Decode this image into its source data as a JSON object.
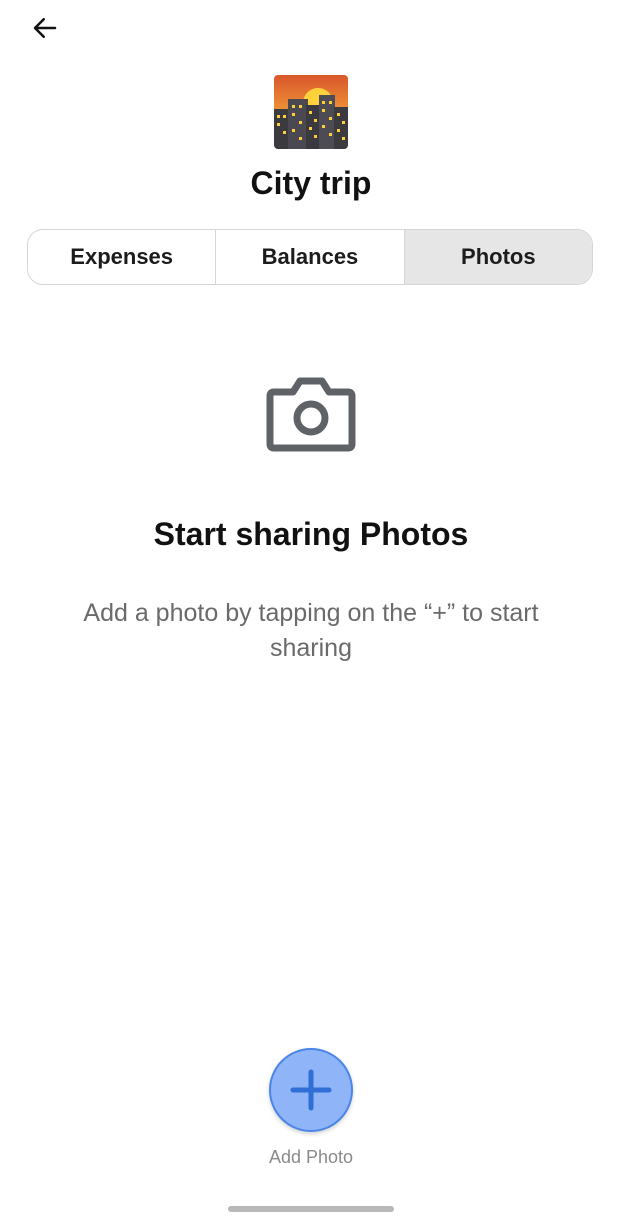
{
  "header": {
    "back_icon": "arrow-left-icon",
    "group_image_icon": "cityscape-sunset-icon",
    "title": "City trip"
  },
  "tabs": [
    {
      "label": "Expenses",
      "active": false
    },
    {
      "label": "Balances",
      "active": false
    },
    {
      "label": "Photos",
      "active": true
    }
  ],
  "empty_state": {
    "icon": "camera-icon",
    "title": "Start sharing Photos",
    "description": "Add a photo by tapping on the “+” to start sharing"
  },
  "fab": {
    "icon": "plus-icon",
    "label": "Add Photo"
  },
  "colors": {
    "fab_fill": "#8fb4f8",
    "fab_border": "#4a86e8",
    "active_tab_bg": "#e6e6e6",
    "camera_icon": "#5f6368"
  }
}
